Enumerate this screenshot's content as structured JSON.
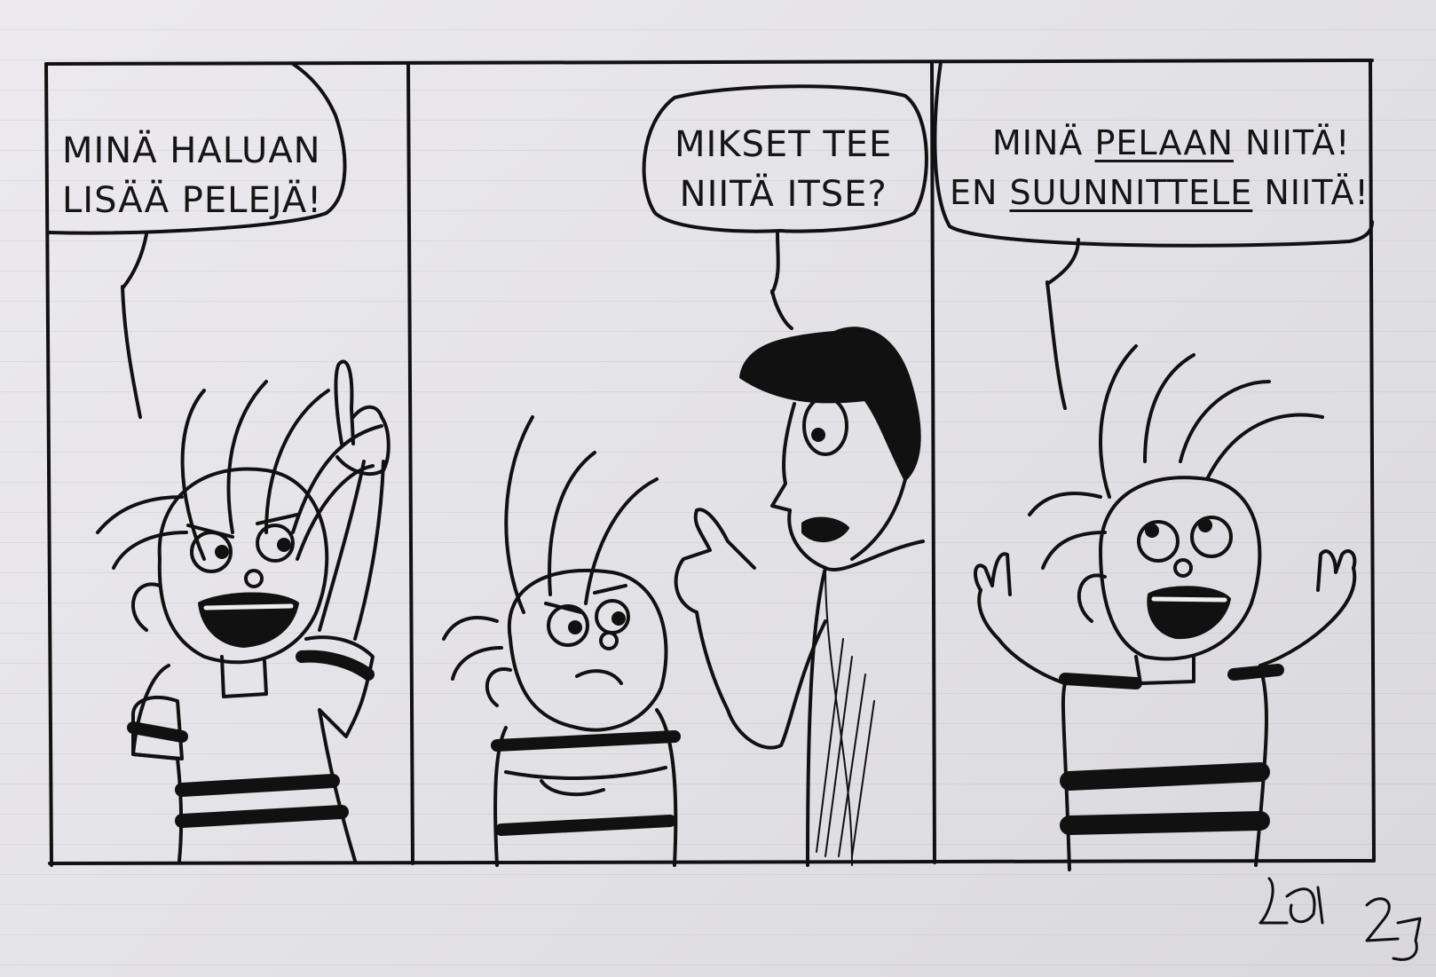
{
  "comic": {
    "panel1": {
      "line1": "MINÄ HALUAN",
      "line2": "LISÄÄ PELEJÄ!"
    },
    "panel2": {
      "line1": "MIKSET TEE",
      "line2": "NIITÄ ITSE?"
    },
    "panel3": {
      "line1_a": "MINÄ ",
      "line1_b": "PELAAN",
      "line1_c": " NIITÄ!",
      "line2_a": "EN ",
      "line2_b": "SUUNNITTELE",
      "line2_c": " NIITÄ!"
    }
  },
  "signature": {
    "initials": "Ledi",
    "number": "25"
  }
}
